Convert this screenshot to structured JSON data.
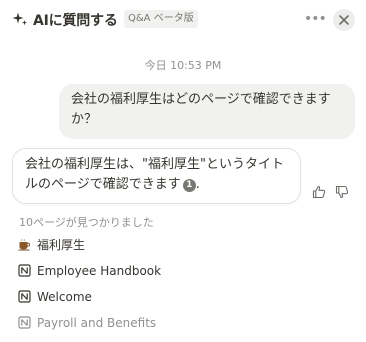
{
  "header": {
    "title": "AIに質問する",
    "badge": "Q&A ベータ版",
    "more_label": "•••"
  },
  "conversation": {
    "timestamp": "今日 10:53 PM",
    "user_message": "会社の福利厚生はどのページで確認できますか？",
    "assistant_message_before": "会社の福利厚生は、\"福利厚生\"というタイトルのページで確認できます",
    "citation_number": "1",
    "assistant_message_after": "."
  },
  "sources": {
    "count_label": "10ページが見つかりました",
    "items": [
      {
        "label": "福利厚生",
        "icon": "coffee-icon"
      },
      {
        "label": "Employee Handbook",
        "icon": "notion-page-icon"
      },
      {
        "label": "Welcome",
        "icon": "notion-page-icon"
      },
      {
        "label": "Payroll and Benefits",
        "icon": "notion-page-icon"
      }
    ]
  }
}
